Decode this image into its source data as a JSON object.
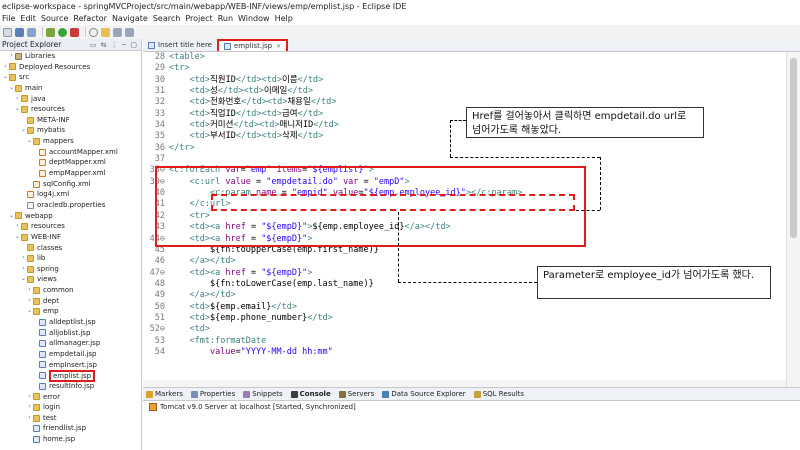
{
  "window": {
    "title": "eclipse-workspace - springMVCProject/src/main/webapp/WEB-INF/views/emp/emplist.jsp - Eclipse IDE"
  },
  "menu": [
    "File",
    "Edit",
    "Source",
    "Refactor",
    "Navigate",
    "Search",
    "Project",
    "Run",
    "Window",
    "Help"
  ],
  "explorer": {
    "title": "Project Explorer",
    "items": [
      {
        "label": "Libraries",
        "indent": 1,
        "arrow": "›",
        "icon": "lib"
      },
      {
        "label": "Deployed Resources",
        "indent": 0,
        "arrow": "›",
        "icon": "folder"
      },
      {
        "label": "src",
        "indent": 0,
        "arrow": "⌄",
        "icon": "folder"
      },
      {
        "label": "main",
        "indent": 1,
        "arrow": "⌄",
        "icon": "folder"
      },
      {
        "label": "java",
        "indent": 2,
        "arrow": "›",
        "icon": "folder"
      },
      {
        "label": "resources",
        "indent": 2,
        "arrow": "⌄",
        "icon": "folder"
      },
      {
        "label": "META-INF",
        "indent": 3,
        "arrow": "",
        "icon": "folder"
      },
      {
        "label": "mybatis",
        "indent": 3,
        "arrow": "⌄",
        "icon": "folder"
      },
      {
        "label": "mappers",
        "indent": 4,
        "arrow": "⌄",
        "icon": "folder"
      },
      {
        "label": "accountMapper.xml",
        "indent": 5,
        "arrow": "",
        "icon": "xml"
      },
      {
        "label": "deptMapper.xml",
        "indent": 5,
        "arrow": "",
        "icon": "xml"
      },
      {
        "label": "empMapper.xml",
        "indent": 5,
        "arrow": "",
        "icon": "xml"
      },
      {
        "label": "sqlConfig.xml",
        "indent": 4,
        "arrow": "",
        "icon": "xml"
      },
      {
        "label": "log4j.xml",
        "indent": 3,
        "arrow": "",
        "icon": "xml"
      },
      {
        "label": "oracledb.properties",
        "indent": 3,
        "arrow": "",
        "icon": "file"
      },
      {
        "label": "webapp",
        "indent": 1,
        "arrow": "⌄",
        "icon": "folder"
      },
      {
        "label": "resources",
        "indent": 2,
        "arrow": "›",
        "icon": "folder"
      },
      {
        "label": "WEB-INF",
        "indent": 2,
        "arrow": "⌄",
        "icon": "folder"
      },
      {
        "label": "classes",
        "indent": 3,
        "arrow": "",
        "icon": "folder"
      },
      {
        "label": "lib",
        "indent": 3,
        "arrow": "›",
        "icon": "folder"
      },
      {
        "label": "spring",
        "indent": 3,
        "arrow": "›",
        "icon": "folder"
      },
      {
        "label": "views",
        "indent": 3,
        "arrow": "⌄",
        "icon": "folder"
      },
      {
        "label": "common",
        "indent": 4,
        "arrow": "›",
        "icon": "folder"
      },
      {
        "label": "dept",
        "indent": 4,
        "arrow": "›",
        "icon": "folder"
      },
      {
        "label": "emp",
        "indent": 4,
        "arrow": "⌄",
        "icon": "folder"
      },
      {
        "label": "alldeptlist.jsp",
        "indent": 5,
        "arrow": "",
        "icon": "jsp"
      },
      {
        "label": "alljoblist.jsp",
        "indent": 5,
        "arrow": "",
        "icon": "jsp"
      },
      {
        "label": "allmanager.jsp",
        "indent": 5,
        "arrow": "",
        "icon": "jsp"
      },
      {
        "label": "empdetail.jsp",
        "indent": 5,
        "arrow": "",
        "icon": "jsp"
      },
      {
        "label": "empInsert.jsp",
        "indent": 5,
        "arrow": "",
        "icon": "jsp"
      },
      {
        "label": "emplist.jsp",
        "indent": 5,
        "arrow": "",
        "icon": "jsp",
        "highlight": true
      },
      {
        "label": "resultInfo.jsp",
        "indent": 5,
        "arrow": "",
        "icon": "jsp"
      },
      {
        "label": "error",
        "indent": 4,
        "arrow": "›",
        "icon": "folder"
      },
      {
        "label": "login",
        "indent": 4,
        "arrow": "›",
        "icon": "folder"
      },
      {
        "label": "test",
        "indent": 4,
        "arrow": "›",
        "icon": "folder"
      },
      {
        "label": "friendlist.jsp",
        "indent": 4,
        "arrow": "",
        "icon": "jsp"
      },
      {
        "label": "home.jsp",
        "indent": 4,
        "arrow": "",
        "icon": "jsp"
      }
    ]
  },
  "editor": {
    "tabs": [
      {
        "label": "Insert title here",
        "active": false
      },
      {
        "label": "emplist.jsp",
        "active": true
      }
    ],
    "lines": [
      {
        "num": "28",
        "code": "<table>"
      },
      {
        "num": "29",
        "code": "<tr>"
      },
      {
        "num": "30",
        "code": "    <td>직원ID</td><td>이름</td>"
      },
      {
        "num": "31",
        "code": "    <td>성</td><td>이메일</td>"
      },
      {
        "num": "32",
        "code": "    <td>전화번호</td><td>채용일</td>"
      },
      {
        "num": "33",
        "code": "    <td>직업ID</td><td>급여</td>"
      },
      {
        "num": "34",
        "code": "    <td>커미션</td><td>매니저ID</td>"
      },
      {
        "num": "35",
        "code": "    <td>부서ID</td><td>삭제</td>"
      },
      {
        "num": "36",
        "code": "</tr>"
      },
      {
        "num": "37",
        "code": ""
      },
      {
        "num": "38⊖",
        "code": "<c:forEach var=\"emp\" items=\"${emplist}\">"
      },
      {
        "num": "39⊖",
        "code": "    <c:url value = \"empdetail.do\" var = \"empD\">"
      },
      {
        "num": "40",
        "code": "        <c:param name = \"empid\" value=\"${emp.employee_id}\"></c:param>"
      },
      {
        "num": "41",
        "code": "    </c:url>"
      },
      {
        "num": "42",
        "code": "    <tr>"
      },
      {
        "num": "43",
        "code": "    <td><a href = \"${empD}\">${emp.employee_id}</a></td>"
      },
      {
        "num": "44⊖",
        "code": "    <td><a href = \"${empD}\">"
      },
      {
        "num": "45",
        "code": "        ${fn:toUpperCase(emp.first_name)}"
      },
      {
        "num": "46",
        "code": "    </a></td>"
      },
      {
        "num": "47⊖",
        "code": "    <td><a href = \"${empD}\">"
      },
      {
        "num": "48",
        "code": "        ${fn:toLowerCase(emp.last_name)}"
      },
      {
        "num": "49",
        "code": "    </a></td>"
      },
      {
        "num": "50",
        "code": "    <td>${emp.email}</td>"
      },
      {
        "num": "51",
        "code": "    <td>${emp.phone_number}</td>"
      },
      {
        "num": "52⊖",
        "code": "    <td>"
      },
      {
        "num": "53",
        "code": "    <fmt:formatDate"
      },
      {
        "num": "54",
        "code": "        value=\"YYYY-MM-dd hh:mm\""
      }
    ]
  },
  "annotations": {
    "top": "Href를 걸어놓아서 클릭하면 empdetail.do url로 넘어가도록 해놓았다.",
    "bottom": "Parameter로 employee_id가 넘어가도록 했다."
  },
  "console": {
    "tabs": [
      "Markers",
      "Properties",
      "Snippets",
      "Console",
      "Servers",
      "Data Source Explorer",
      "SQL Results"
    ],
    "active_tab": "Console",
    "server_line": "Tomcat v9.0 Server at localhost  [Started, Synchronized]"
  },
  "colors": {
    "tag": "#3f7f7f",
    "attr": "#7f007f",
    "string": "#2a00ff",
    "el": "#000000",
    "text": "#000000",
    "highlight_red": "#e01d1d"
  }
}
